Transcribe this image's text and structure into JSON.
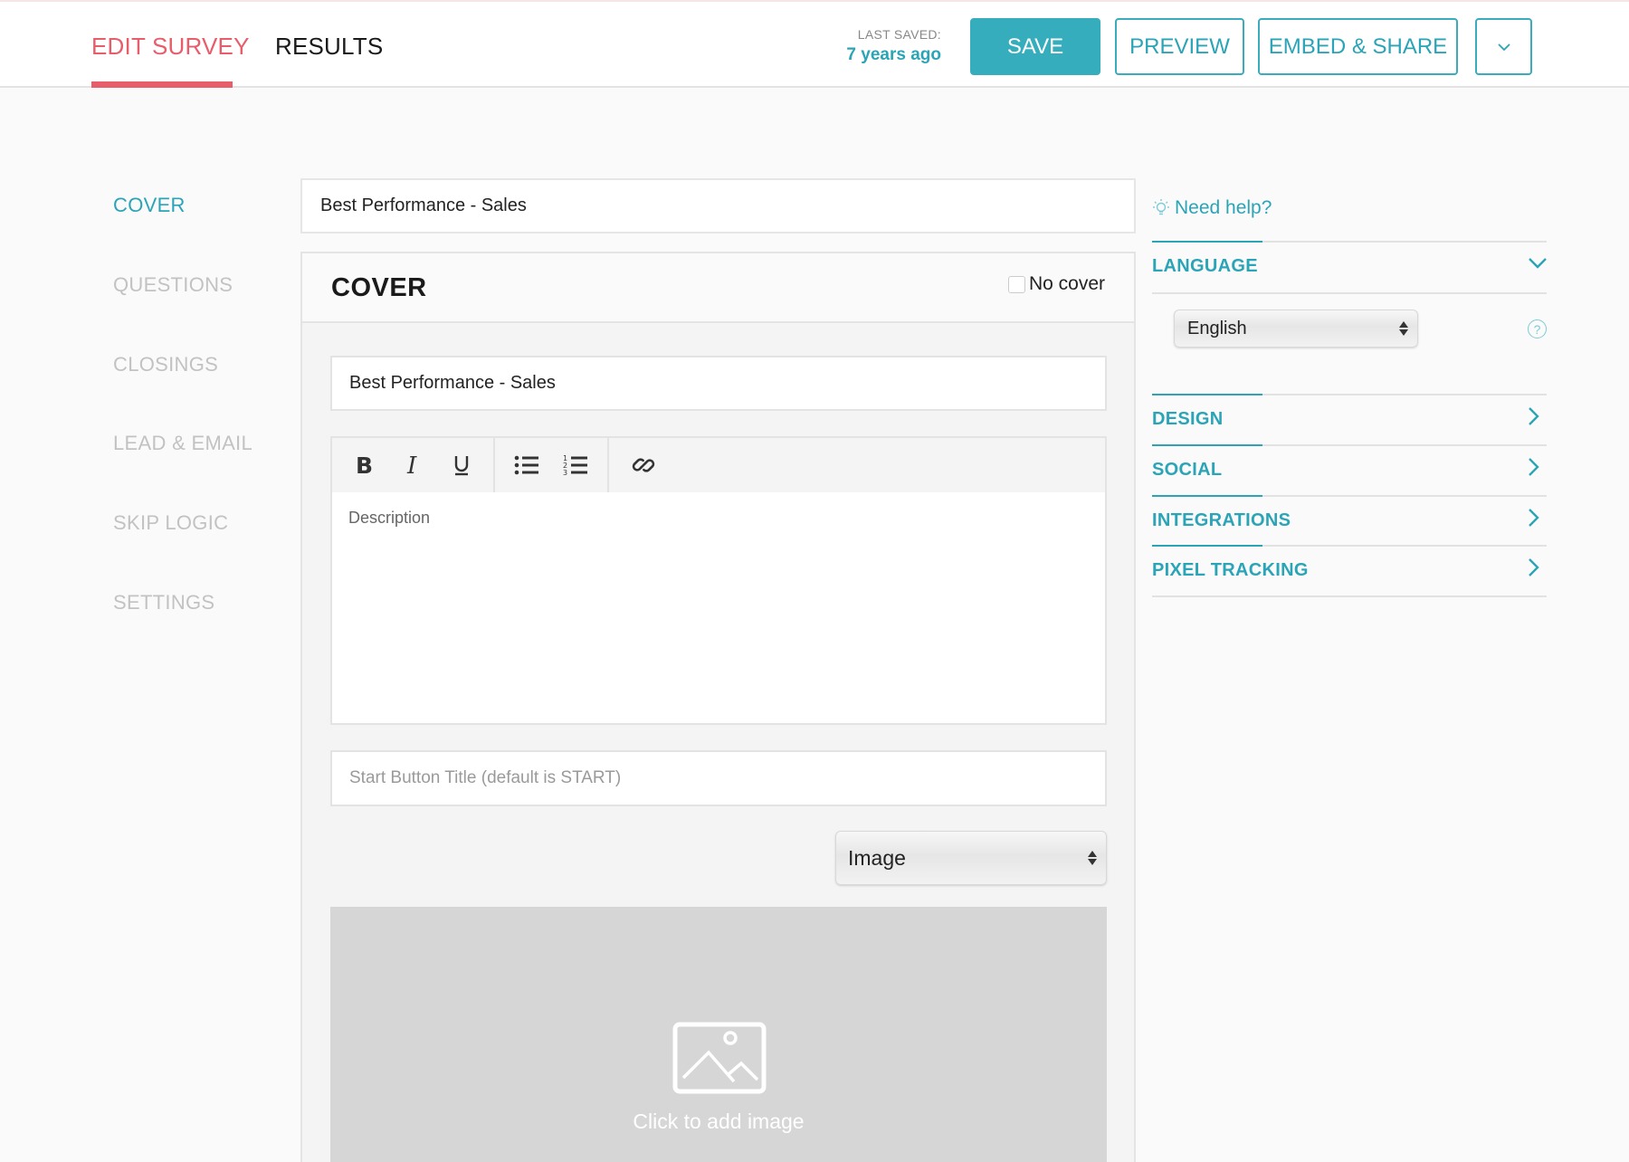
{
  "header": {
    "tabs": [
      {
        "label": "EDIT SURVEY",
        "active": true
      },
      {
        "label": "RESULTS",
        "active": false
      }
    ],
    "last_saved_label": "LAST SAVED:",
    "last_saved_value": "7 years ago",
    "buttons": {
      "save": "SAVE",
      "preview": "PREVIEW",
      "embed_share": "EMBED & SHARE",
      "more_icon": "chevron-down-icon"
    }
  },
  "sidebar": {
    "items": [
      {
        "label": "COVER",
        "active": true
      },
      {
        "label": "QUESTIONS",
        "active": false
      },
      {
        "label": "CLOSINGS",
        "active": false
      },
      {
        "label": "LEAD & EMAIL",
        "active": false
      },
      {
        "label": "SKIP LOGIC",
        "active": false
      },
      {
        "label": "SETTINGS",
        "active": false
      }
    ]
  },
  "main": {
    "survey_title": "Best Performance - Sales",
    "cover": {
      "heading": "COVER",
      "no_cover_label": "No cover",
      "no_cover_checked": false,
      "title_value": "Best Performance - Sales",
      "toolbar": [
        "bold-icon",
        "italic-icon",
        "underline-icon",
        "bulleted-list-icon",
        "numbered-list-icon",
        "link-icon"
      ],
      "description_placeholder": "Description",
      "start_button_placeholder": "Start Button Title (default is START)",
      "media_type": "Image",
      "add_image_text": "Click to add image"
    }
  },
  "right_panel": {
    "help_label": "Need help?",
    "sections": [
      {
        "label": "LANGUAGE",
        "expanded": true
      },
      {
        "label": "DESIGN",
        "expanded": false
      },
      {
        "label": "SOCIAL",
        "expanded": false
      },
      {
        "label": "INTEGRATIONS",
        "expanded": false
      },
      {
        "label": "PIXEL TRACKING",
        "expanded": false
      }
    ],
    "language_value": "English",
    "language_help": "?"
  },
  "colors": {
    "accent": "#2aa4b6",
    "active_tab": "#e85d6a",
    "image_placeholder_bg": "#d6d6d6"
  }
}
